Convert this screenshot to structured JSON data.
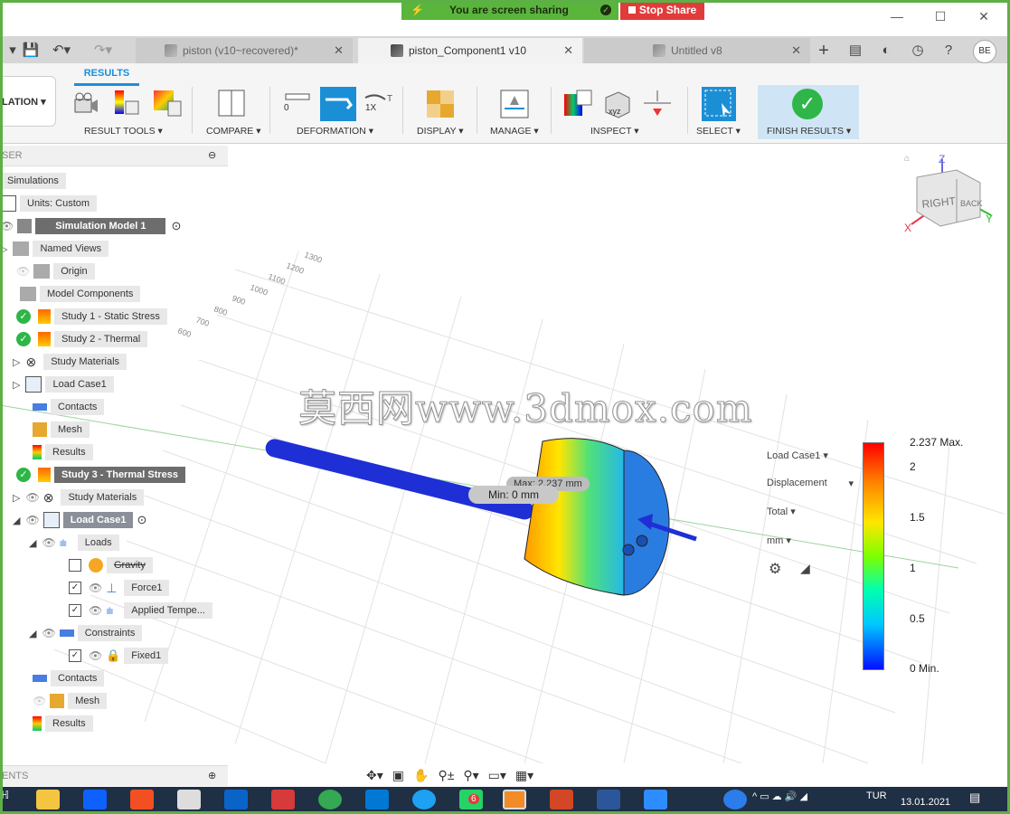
{
  "share_banner": {
    "text": "You are screen sharing",
    "stop_label": "Stop Share"
  },
  "window_controls": {
    "minimize": "—",
    "maximize": "☐",
    "close": "✕"
  },
  "tabs": [
    {
      "label": "piston (v10~recovered)*",
      "active": false
    },
    {
      "label": "piston_Component1 v10",
      "active": true
    },
    {
      "label": "Untitled v8",
      "active": false
    }
  ],
  "tab_close": "✕",
  "toolbar": {
    "add_tab": "+",
    "user_initials": "BE"
  },
  "ribbon": {
    "active_tab": "RESULTS",
    "workspace": "LATION ▾",
    "groups": [
      {
        "label": "RESULT TOOLS ▾"
      },
      {
        "label": "COMPARE ▾"
      },
      {
        "label": "DEFORMATION ▾"
      },
      {
        "label": "DISPLAY ▾"
      },
      {
        "label": "MANAGE ▾"
      },
      {
        "label": "INSPECT ▾"
      },
      {
        "label": "SELECT ▾"
      },
      {
        "label": "FINISH RESULTS ▾"
      }
    ],
    "deformation_scale_a": "0",
    "deformation_scale_b": "1X",
    "inspect_xyz": "xyz"
  },
  "browser": {
    "header": "SER",
    "items": [
      {
        "label": "Simulations"
      },
      {
        "label": "Units: Custom"
      },
      {
        "label": "Simulation Model 1"
      },
      {
        "label": "Named Views"
      },
      {
        "label": "Origin"
      },
      {
        "label": "Model Components"
      },
      {
        "label": "Study 1 - Static Stress"
      },
      {
        "label": "Study 2 - Thermal"
      },
      {
        "label": "Study Materials"
      },
      {
        "label": "Load Case1"
      },
      {
        "label": "Contacts"
      },
      {
        "label": "Mesh"
      },
      {
        "label": "Results"
      },
      {
        "label": "Study 3 - Thermal Stress"
      },
      {
        "label": "Study Materials"
      },
      {
        "label": "Load Case1"
      },
      {
        "label": "Loads"
      },
      {
        "label": "Gravity"
      },
      {
        "label": "Force1"
      },
      {
        "label": "Applied Tempe..."
      },
      {
        "label": "Constraints"
      },
      {
        "label": "Fixed1"
      },
      {
        "label": "Contacts"
      },
      {
        "label": "Mesh"
      },
      {
        "label": "Results"
      }
    ],
    "footer": "ENTS"
  },
  "viewcube": {
    "right": "RIGHT",
    "back": "BACK",
    "axis_z": "Z",
    "axis_x": "X",
    "axis_y": "Y"
  },
  "grid_ticks": [
    "1300",
    "1200",
    "1100",
    "1000",
    "900",
    "800",
    "700",
    "600"
  ],
  "viewport": {
    "watermark": "莫西网www.3dmox.com",
    "max_label": "Max: 2.237 mm",
    "min_label": "Min: 0 mm"
  },
  "legend": {
    "load_case": "Load Case1 ▾",
    "result_type": "Displacement",
    "component": "Total ▾",
    "unit": "mm ▾",
    "ticks": [
      "2.237 Max.",
      "2",
      "1.5",
      "1",
      "0.5",
      "0 Min."
    ]
  },
  "taskbar": {
    "lang": "TUR",
    "date": "13.01.2021",
    "badge": "6"
  },
  "colors": {
    "accent": "#1b8fd6",
    "share_green": "#59b53b",
    "stop_red": "#e23b3b",
    "frame_green": "#5cb046",
    "taskbar": "#1f2f44"
  }
}
